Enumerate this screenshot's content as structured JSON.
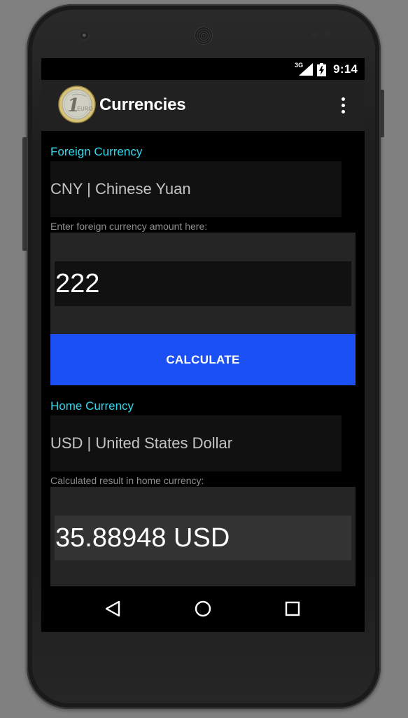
{
  "status_bar": {
    "network": "3G",
    "time": "9:14"
  },
  "app_bar": {
    "title": "Currencies",
    "logo_icon": "euro-coin-icon",
    "menu_icon": "overflow-menu-icon"
  },
  "foreign": {
    "label": "Foreign Currency",
    "selected": "CNY | Chinese Yuan",
    "hint": "Enter foreign currency amount here:",
    "amount": "222"
  },
  "calculate_button": {
    "label": "CALCULATE",
    "color": "#1b50f5"
  },
  "home": {
    "label": "Home Currency",
    "selected": "USD | United States Dollar",
    "hint": "Calculated result in home currency:",
    "result": "35.88948 USD"
  },
  "nav_bar": {
    "back_icon": "back-triangle-icon",
    "home_icon": "home-circle-icon",
    "recents_icon": "recents-square-icon"
  },
  "colors": {
    "accent": "#33d8ee",
    "app_bar": "#212121",
    "background": "#000000"
  }
}
